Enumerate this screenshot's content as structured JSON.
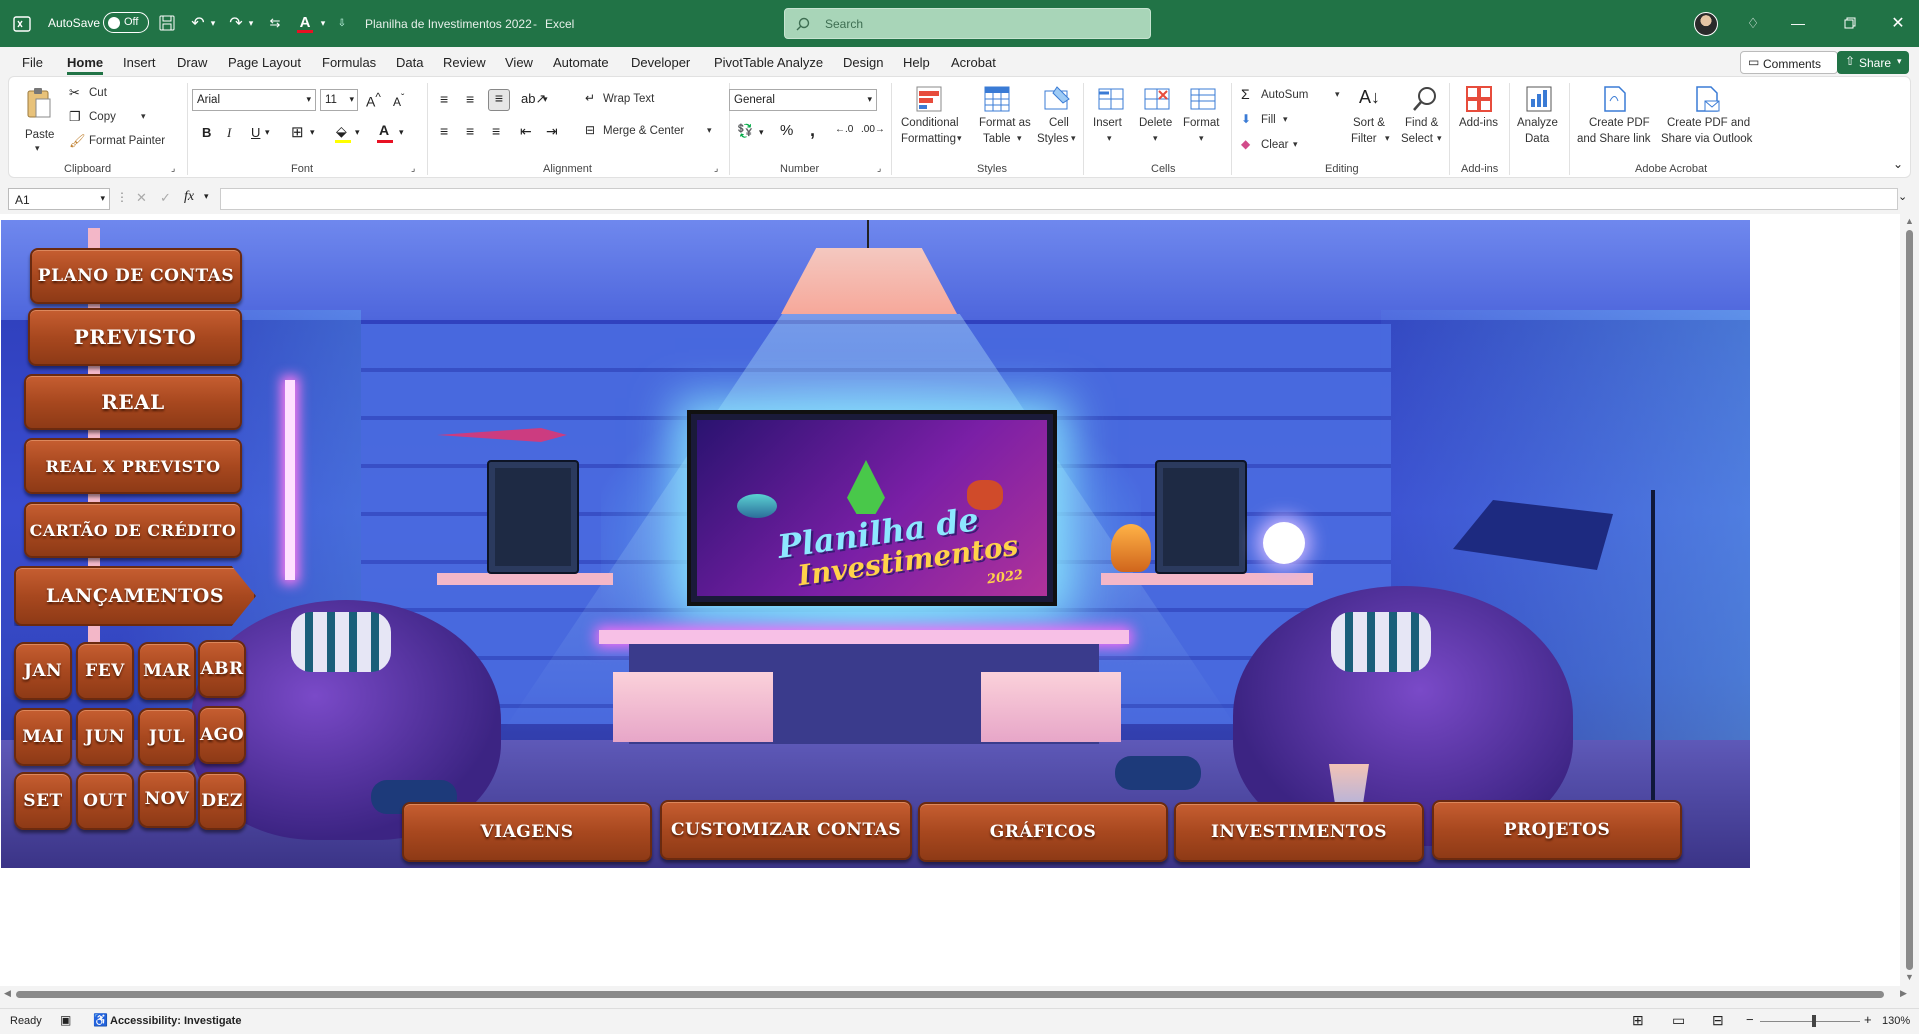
{
  "titlebar": {
    "autosave_label": "AutoSave",
    "autosave_state": "Off",
    "doc_title": "Planilha de Investimentos 2022",
    "app_sep": "-",
    "app_name": "Excel",
    "search_placeholder": "Search"
  },
  "tabs": [
    "File",
    "Home",
    "Insert",
    "Draw",
    "Page Layout",
    "Formulas",
    "Data",
    "Review",
    "View",
    "Automate",
    "Developer",
    "PivotTable Analyze",
    "Design",
    "Help",
    "Acrobat"
  ],
  "tab_right": {
    "comments": "Comments",
    "share": "Share"
  },
  "ribbon": {
    "clipboard": {
      "paste": "Paste",
      "cut": "Cut",
      "copy": "Copy",
      "format_painter": "Format Painter",
      "group": "Clipboard"
    },
    "font": {
      "name": "Arial",
      "size": "11",
      "group": "Font"
    },
    "alignment": {
      "wrap": "Wrap Text",
      "merge": "Merge & Center",
      "group": "Alignment"
    },
    "number": {
      "format": "General",
      "group": "Number"
    },
    "styles": {
      "conditional": [
        "Conditional",
        "Formatting"
      ],
      "format_table": [
        "Format as",
        "Table"
      ],
      "cell_styles": [
        "Cell",
        "Styles"
      ],
      "group": "Styles"
    },
    "cells": {
      "insert": "Insert",
      "delete": "Delete",
      "format": "Format",
      "group": "Cells"
    },
    "editing": {
      "autosum": "AutoSum",
      "fill": "Fill",
      "clear": "Clear",
      "sort": [
        "Sort &",
        "Filter"
      ],
      "find": [
        "Find &",
        "Select"
      ],
      "group": "Editing"
    },
    "addins": {
      "addins": "Add-ins",
      "group": "Add-ins"
    },
    "analyze": [
      "Analyze",
      "Data"
    ],
    "acrobat": {
      "pdf_link": [
        "Create PDF",
        "and Share link"
      ],
      "pdf_outlook": [
        "Create PDF and",
        "Share via Outlook"
      ],
      "group": "Adobe Acrobat"
    }
  },
  "formula_bar": {
    "cell_ref": "A1",
    "fx": "fx",
    "value": ""
  },
  "dashboard": {
    "side_menu": [
      "PLANO DE CONTAS",
      "PREVISTO",
      "REAL",
      "REAL X PREVISTO",
      "CARTÃO DE CRÉDITO",
      "LANÇAMENTOS"
    ],
    "months": [
      "JAN",
      "FEV",
      "MAR",
      "ABR",
      "MAI",
      "JUN",
      "JUL",
      "AGO",
      "SET",
      "OUT",
      "NOV",
      "DEZ"
    ],
    "bottom_menu": [
      "VIAGENS",
      "CUSTOMIZAR CONTAS",
      "GRÁFICOS",
      "INVESTIMENTOS",
      "PROJETOS"
    ],
    "tv_title_1": "Planilha de",
    "tv_title_2": "Investimentos",
    "tv_year": "2022"
  },
  "status": {
    "ready": "Ready",
    "accessibility": "Accessibility: Investigate",
    "zoom": "130%"
  }
}
